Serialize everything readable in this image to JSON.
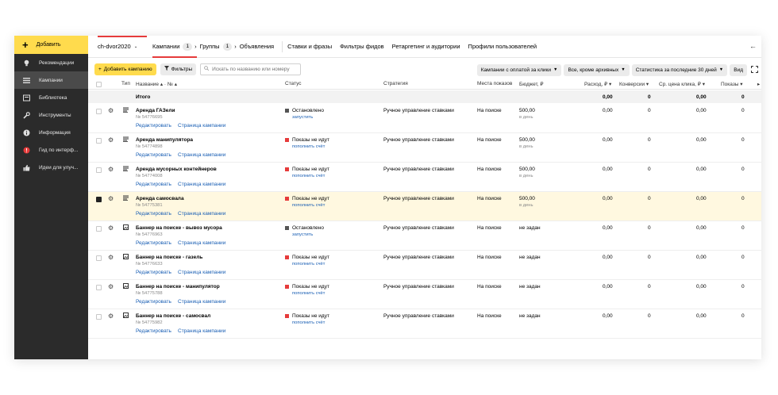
{
  "sidebar": {
    "add_label": "Добавить",
    "items": [
      {
        "label": "Рекомендации",
        "icon": "lightbulb-icon"
      },
      {
        "label": "Кампании",
        "icon": "list-icon",
        "active": true
      },
      {
        "label": "Библиотека",
        "icon": "library-icon"
      },
      {
        "label": "Инструменты",
        "icon": "wrench-icon"
      },
      {
        "label": "Информация",
        "icon": "info-icon"
      },
      {
        "label": "Гид по интерф...",
        "icon": "guide-icon"
      },
      {
        "label": "Идеи для улуч...",
        "icon": "thumbs-up-icon"
      }
    ]
  },
  "topbar": {
    "account": "ch-dvor2020",
    "tabs": [
      {
        "label": "Кампании",
        "count": "1"
      },
      {
        "label": "Группы",
        "count": "1"
      },
      {
        "label": "Объявления"
      }
    ],
    "links": [
      "Ставки и фразы",
      "Фильтры фидов",
      "Ретаргетинг и аудитории",
      "Профили пользователей"
    ]
  },
  "toolbar": {
    "add_campaign": "Добавить кампанию",
    "filters": "Фильтры",
    "search_placeholder": "Искать по названию или номеру",
    "payment": "Кампании с оплатой за клики",
    "archive": "Все, кроме архивных",
    "stats": "Статистика за последние 30 дней",
    "view": "Вид"
  },
  "table": {
    "headers": {
      "type": "Тип",
      "name": "Название",
      "num": "№",
      "status": "Статус",
      "strategy": "Стратегия",
      "places": "Места показов",
      "budget": "Бюджет, ₽",
      "spend": "Расход, ₽",
      "conv": "Конверсии",
      "cpc": "Ср. цена клика, ₽",
      "shows": "Показы"
    },
    "total": {
      "label": "Итого",
      "spend": "0,00",
      "conv": "0",
      "cpc": "0,00",
      "shows": "0"
    },
    "rows": [
      {
        "name": "Аренда ГАЗели",
        "num": "№ 54776695",
        "status": "Остановлено",
        "status_color": "#555555",
        "status_link": "запустить",
        "strategy": "Ручное управление ставками",
        "places": "На поиске",
        "budget": "500,00",
        "budget_sub": "в день",
        "spend": "0,00",
        "conv": "0",
        "cpc": "0,00",
        "shows": "0",
        "edit": "Редактировать",
        "page": "Страница кампании",
        "checked": false,
        "type_icon": "text-ad-icon"
      },
      {
        "name": "Аренда манипулятора",
        "num": "№ 54774898",
        "status": "Показы не идут",
        "status_color": "#e63b3b",
        "status_link": "пополнить счёт",
        "strategy": "Ручное управление ставками",
        "places": "На поиске",
        "budget": "500,00",
        "budget_sub": "в день",
        "spend": "0,00",
        "conv": "0",
        "cpc": "0,00",
        "shows": "0",
        "edit": "Редактировать",
        "page": "Страница кампании",
        "checked": false,
        "type_icon": "text-ad-icon"
      },
      {
        "name": "Аренда мусорных контейнеров",
        "num": "№ 54774008",
        "status": "Показы не идут",
        "status_color": "#e63b3b",
        "status_link": "пополнить счёт",
        "strategy": "Ручное управление ставками",
        "places": "На поиске",
        "budget": "500,00",
        "budget_sub": "в день",
        "spend": "0,00",
        "conv": "0",
        "cpc": "0,00",
        "shows": "0",
        "edit": "Редактировать",
        "page": "Страница кампании",
        "checked": false,
        "type_icon": "text-ad-icon"
      },
      {
        "name": "Аренда самосвала",
        "num": "№ 54775381",
        "status": "Показы не идут",
        "status_color": "#e63b3b",
        "status_link": "пополнить счёт",
        "strategy": "Ручное управление ставками",
        "places": "На поиске",
        "budget": "500,00",
        "budget_sub": "в день",
        "spend": "0,00",
        "conv": "0",
        "cpc": "0,00",
        "shows": "0",
        "edit": "Редактировать",
        "page": "Страница кампании",
        "checked": true,
        "type_icon": "text-ad-icon"
      },
      {
        "name": "Баннер на поиске - вывоз мусора",
        "num": "№ 54776963",
        "status": "Остановлено",
        "status_color": "#555555",
        "status_link": "запустить",
        "strategy": "Ручное управление ставками",
        "places": "На поиске",
        "budget": "не задан",
        "budget_sub": "",
        "spend": "0,00",
        "conv": "0",
        "cpc": "0,00",
        "shows": "0",
        "edit": "Редактировать",
        "page": "Страница кампании",
        "checked": false,
        "type_icon": "banner-icon"
      },
      {
        "name": "Баннер на поиске - газель",
        "num": "№ 54776633",
        "status": "Показы не идут",
        "status_color": "#e63b3b",
        "status_link": "пополнить счёт",
        "strategy": "Ручное управление ставками",
        "places": "На поиске",
        "budget": "не задан",
        "budget_sub": "",
        "spend": "0,00",
        "conv": "0",
        "cpc": "0,00",
        "shows": "0",
        "edit": "Редактировать",
        "page": "Страница кампании",
        "checked": false,
        "type_icon": "banner-icon"
      },
      {
        "name": "Баннер на поиске - манипулятор",
        "num": "№ 54775788",
        "status": "Показы не идут",
        "status_color": "#e63b3b",
        "status_link": "пополнить счёт",
        "strategy": "Ручное управление ставками",
        "places": "На поиске",
        "budget": "не задан",
        "budget_sub": "",
        "spend": "0,00",
        "conv": "0",
        "cpc": "0,00",
        "shows": "0",
        "edit": "Редактировать",
        "page": "Страница кампании",
        "checked": false,
        "type_icon": "banner-icon"
      },
      {
        "name": "Баннер на поиске - самосвал",
        "num": "№ 54775982",
        "status": "Показы не идут",
        "status_color": "#e63b3b",
        "status_link": "пополнить счёт",
        "strategy": "Ручное управление ставками",
        "places": "На поиске",
        "budget": "не задан",
        "budget_sub": "",
        "spend": "0,00",
        "conv": "0",
        "cpc": "0,00",
        "shows": "0",
        "edit": "Редактировать",
        "page": "Страница кампании",
        "checked": false,
        "type_icon": "banner-icon"
      }
    ]
  }
}
